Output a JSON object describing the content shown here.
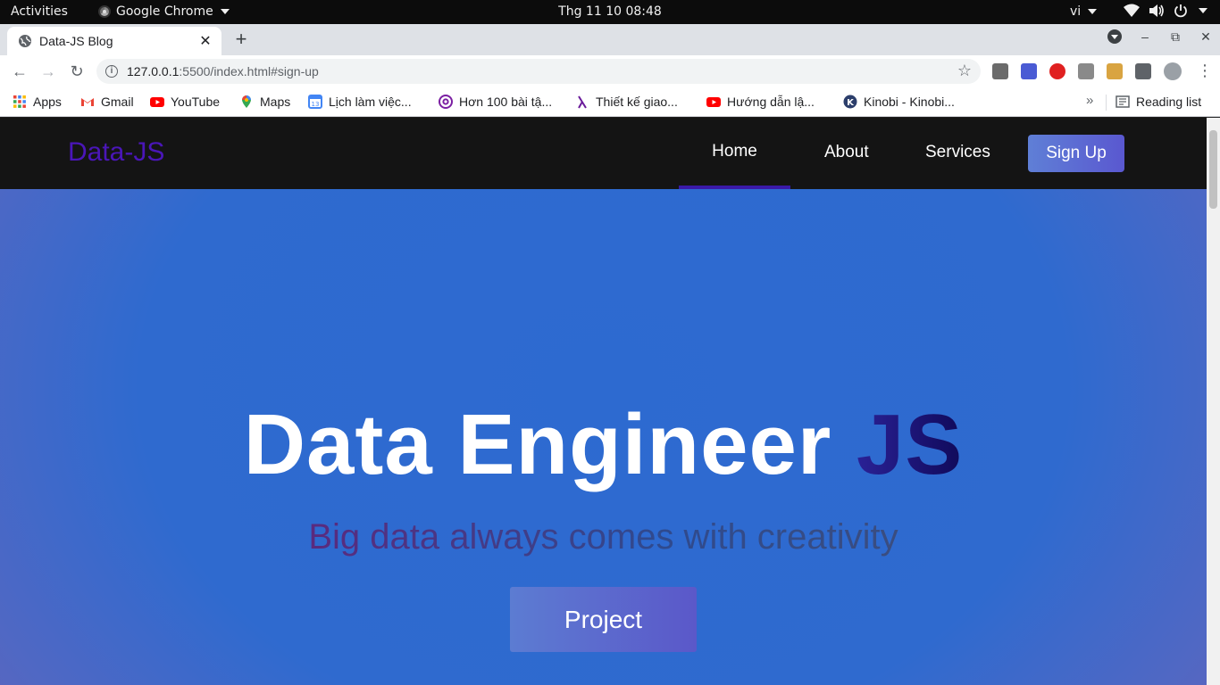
{
  "system_bar": {
    "activities": "Activities",
    "app_name": "Google Chrome",
    "clock": "Thg 11 10  08:48",
    "language": "vi"
  },
  "browser": {
    "tab_title": "Data-JS Blog",
    "url_host": "127.0.0.1",
    "url_rest": ":5500/index.html#sign-up",
    "bookmarks": [
      {
        "label": "Apps",
        "icon": "apps-grid-icon"
      },
      {
        "label": "Gmail",
        "icon": "gmail-icon"
      },
      {
        "label": "YouTube",
        "icon": "youtube-icon"
      },
      {
        "label": "Maps",
        "icon": "maps-icon"
      },
      {
        "label": "Lịch làm việc...",
        "icon": "calendar-icon"
      },
      {
        "label": "Hơn 100 bài tậ...",
        "icon": "at-sign-icon"
      },
      {
        "label": "Thiết kế giao...",
        "icon": "lambda-icon"
      },
      {
        "label": "Hướng dẫn lậ...",
        "icon": "youtube-icon"
      },
      {
        "label": "Kinobi - Kinobi...",
        "icon": "kinobi-icon"
      }
    ],
    "reading_list": "Reading list"
  },
  "site": {
    "logo": "Data-JS",
    "nav": {
      "home": "Home",
      "about": "About",
      "services": "Services",
      "signup": "Sign Up"
    },
    "hero": {
      "title_main": "Data Engineer",
      "title_accent": "JS",
      "subtitle": "Big data always comes with creativity",
      "cta": "Project"
    }
  },
  "colors": {
    "nav_bg": "#141414",
    "logo": "#4a16b8",
    "hero_blue": "#2f6acf",
    "hero_edge": "#6a62b8",
    "button": "#5b6ed0"
  }
}
